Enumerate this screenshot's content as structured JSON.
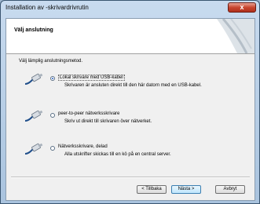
{
  "window": {
    "title": "Installation av -skrivardrivrutin",
    "close_glyph": "x"
  },
  "header": {
    "title": "Välj anslutning"
  },
  "prompt": "Välj lämplig anslutningsmetod.",
  "options": [
    {
      "label": "Lokal skrivare med USB-kabel",
      "description": "Skrivaren är ansluten direkt till den här datorn med en USB-kabel.",
      "selected": true,
      "icon": "usb-cable-icon"
    },
    {
      "label": "peer-to-peer nätverksskrivare",
      "description": "Skriv ut direkt till skrivaren över nätverket.",
      "selected": false,
      "icon": "network-cable-icon"
    },
    {
      "label": "Nätverksskrivare, delad",
      "description": "Alla utskrifter skickas till en kö på en central server.",
      "selected": false,
      "icon": "network-cable-icon"
    }
  ],
  "buttons": {
    "back": "< Tillbaka",
    "next": "Nästa >",
    "cancel": "Avbryt"
  },
  "colors": {
    "accent": "#2a62c8",
    "close_button": "#c8452f"
  }
}
